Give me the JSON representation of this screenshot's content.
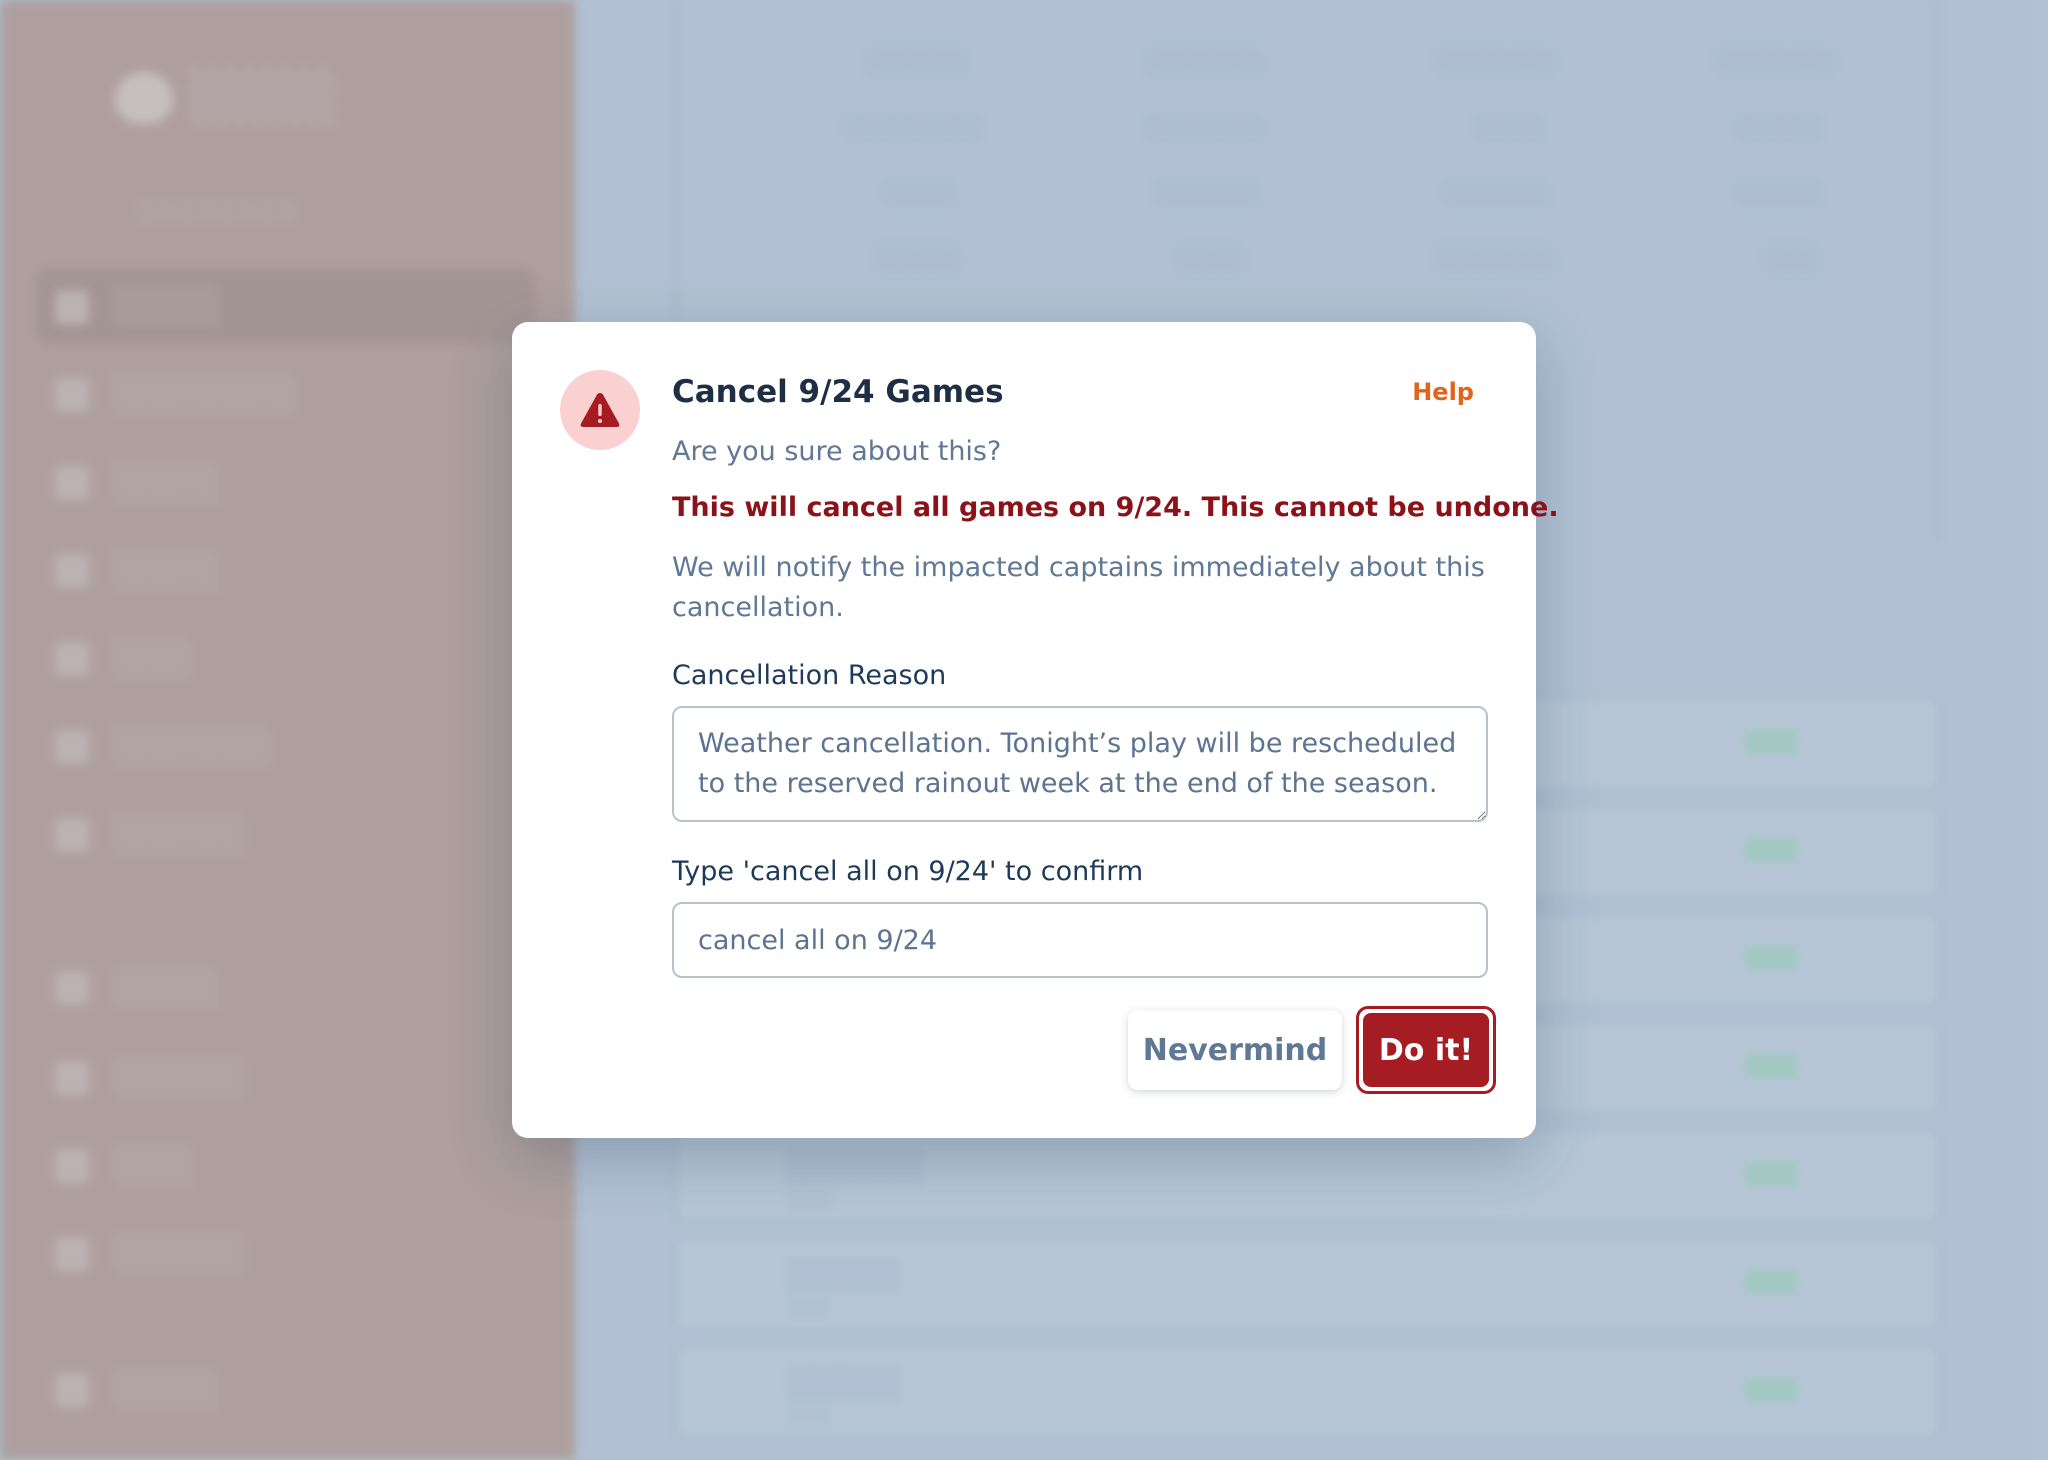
{
  "modal": {
    "title": "Cancel 9/24 Games",
    "help_label": "Help",
    "subtitle": "Are you sure about this?",
    "warning": "This will cancel all games on 9/24. This cannot be undone.",
    "notify_text": "We will notify the impacted captains immediately about this cancellation.",
    "reason_label": "Cancellation Reason",
    "reason_value": "Weather cancellation. Tonight’s play will be rescheduled to the reserved rainout week at the end of the season.",
    "confirm_label": "Type 'cancel all on 9/24' to confirm",
    "confirm_value": "cancel all on 9/24",
    "cancel_button": "Nevermind",
    "confirm_button": "Do it!"
  },
  "colors": {
    "danger": "#a51d23",
    "danger_text": "#8b1218",
    "help_accent": "#e0641c",
    "warning_circle": "#fbd0d0"
  },
  "icons": {
    "modal_icon": "warning-triangle-icon"
  }
}
